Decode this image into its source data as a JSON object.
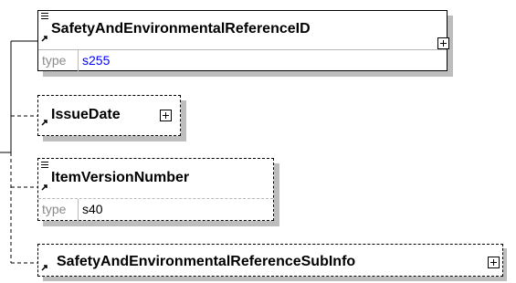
{
  "elements": [
    {
      "name": "SafetyAndEnvironmentalReferenceID",
      "type_label": "type",
      "type_value": "s255",
      "type_value_color": "#0000ff",
      "optional": false,
      "expandable": true
    },
    {
      "name": "IssueDate",
      "optional": true,
      "expandable": true
    },
    {
      "name": "ItemVersionNumber",
      "type_label": "type",
      "type_value": "s40",
      "type_value_color": "#000000",
      "optional": true,
      "expandable": false
    },
    {
      "name": "SafetyAndEnvironmentalReferenceSubInfo",
      "optional": true,
      "expandable": true
    }
  ],
  "icons": [
    "documentation-lines-icon",
    "reference-arrow-icon",
    "expand-plus-icon"
  ],
  "colors": {
    "shadow": "#bdbdbd",
    "border": "#000000",
    "type_divider": "#b8b8b8",
    "type_label": "#8a8a8a"
  }
}
